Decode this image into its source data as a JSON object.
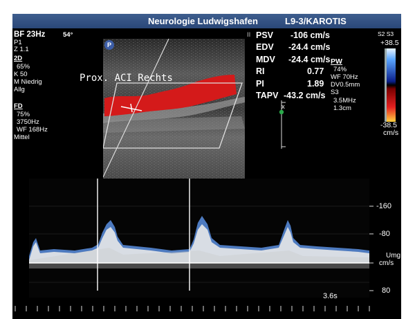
{
  "header": {
    "clinic": "Neurologie Ludwigshafen",
    "probe": "L9-3/KAROTIS"
  },
  "left_params": {
    "frame_rate": "BF 23Hz",
    "angle": "54°",
    "p": "P1",
    "z": "Z 1.1",
    "section_2d": "2D",
    "gain_2d": "65%",
    "k": "K 50",
    "m": "M Niedrig",
    "preset": "Allg",
    "section_fd": "FD",
    "gain_fd": "75%",
    "prf": "3750Hz",
    "wf": "WF 168Hz",
    "mode": "Mittel"
  },
  "measurements": {
    "psv_label": "PSV",
    "psv_value": "-106 cm/s",
    "edv_label": "EDV",
    "edv_value": "-24.4 cm/s",
    "mdv_label": "MDV",
    "mdv_value": "-24.4 cm/s",
    "ri_label": "RI",
    "ri_value": "0.77",
    "pi_label": "PI",
    "pi_value": "1.89",
    "tapv_label": "TAPV",
    "tapv_value": "-43.2 cm/s"
  },
  "pw_params": {
    "section": "PW",
    "gain": "74%",
    "wf": "WF 70Hz",
    "dv": "DV0.5mm",
    "s": "S3",
    "freq": "3.5MHz",
    "depth": "1.3cm"
  },
  "colorbar": {
    "header": "S2 S3",
    "top_value": "+38.5",
    "bottom_value": "-38.5",
    "unit": "cm/s"
  },
  "pause_symbol": "II",
  "probe_badge": "P",
  "bmode": {
    "overlay_text": "Prox. ACI  Rechts"
  },
  "depth_marker": {
    "label": "x"
  },
  "doppler": {
    "scale_labels": [
      "-160",
      "-80",
      "80"
    ],
    "unit_upper": "Umg",
    "unit_lower": "cm/s",
    "time_label": "3.6s"
  },
  "colors": {
    "flow": "#d41a1a",
    "spectrum_blue": "#5a8fe0",
    "titlebar": "#2f4f80"
  }
}
